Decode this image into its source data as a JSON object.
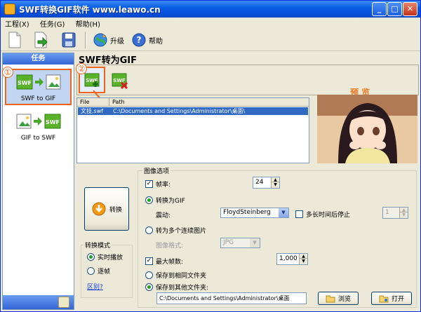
{
  "window": {
    "title": "SWF转换GIF软件 www.leawo.cn"
  },
  "menu": [
    "工程(X)",
    "任务(G)",
    "帮助(H)"
  ],
  "toolbar": {
    "upgrade_label": "升级",
    "help_label": "帮助"
  },
  "left_panel": {
    "header": "任务",
    "tasks": [
      {
        "label": "SWF to GIF",
        "selected": true
      },
      {
        "label": "GIF to SWF",
        "selected": false
      }
    ],
    "marker1": "①"
  },
  "main": {
    "heading": "SWF转为GIF",
    "marker2": "②",
    "preview_label": "预 览",
    "file_list": {
      "columns": [
        "File",
        "Path"
      ],
      "rows": [
        {
          "file": "文技.swf",
          "path": "C:\\Documents and Settings\\Administrator\\桌面\\"
        }
      ]
    },
    "convert_button": "转换",
    "convert_mode": {
      "legend": "转换模式",
      "options": [
        "实时播放",
        "逐帧"
      ],
      "selected": "实时播放",
      "diff_link": "区别?"
    },
    "image_options": {
      "legend": "图像选项",
      "frame_rate_label": "帧率:",
      "frame_rate_value": "24",
      "to_gif_label": "转换为GIF",
      "dither_label": "震动:",
      "dither_value": "FloydSteinberg",
      "stop_long_label": "多长时间后停止",
      "stop_long_value": "1",
      "to_images_label": "转为多个连续图片",
      "image_format_label": "图像格式:",
      "image_format_value": "JPG",
      "max_frames_label": "最大帧数:",
      "max_frames_value": "1,000",
      "save_same_label": "保存到相同文件夹",
      "save_other_label": "保存到其他文件夹:",
      "output_path": "C:\\Documents and Settings\\Administrator\\桌面",
      "browse_label": "浏览",
      "open_label": "打开"
    }
  },
  "colors": {
    "title_bar": "#0A5FE4",
    "selection": "#316AC5",
    "accent": "#F0641E",
    "preview_label": "#F07820"
  }
}
